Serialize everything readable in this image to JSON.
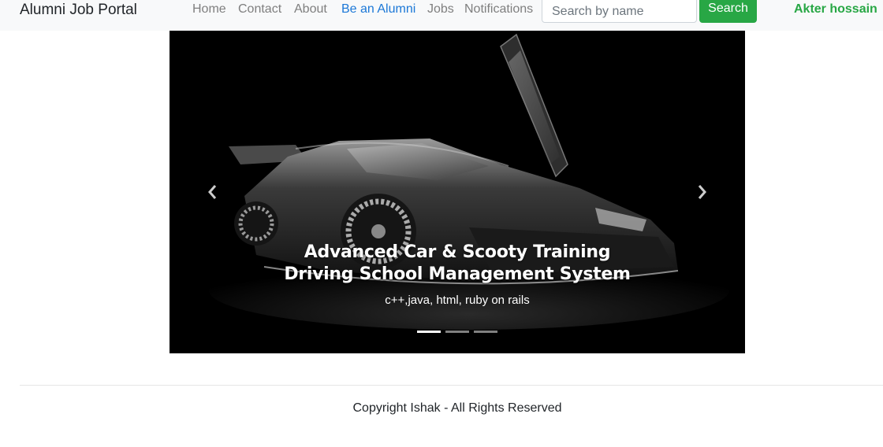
{
  "navbar": {
    "brand": "Alumni Job Portal",
    "links": [
      "Home",
      "Contact",
      "About",
      "Be an Alumni",
      "Jobs",
      "Notifications"
    ],
    "active_link": "Be an Alumni",
    "search": {
      "placeholder": "Search by name",
      "value": ""
    },
    "search_button": "Search",
    "user": "Akter hossain"
  },
  "carousel": {
    "caption_title": "Advanced Car & Scooty Training Driving School Management System",
    "caption_text": "c++,java, html, ruby on rails",
    "slides_count": 3,
    "active_slide": 1,
    "prev_icon": "chevron-left-icon",
    "next_icon": "chevron-right-icon"
  },
  "footer": {
    "copyright": "Copyright Ishak - All Rights Reserved"
  },
  "colors": {
    "accent_green": "#28a745",
    "active_link": "#1c78d7",
    "nav_bg": "#f8f9fa"
  }
}
